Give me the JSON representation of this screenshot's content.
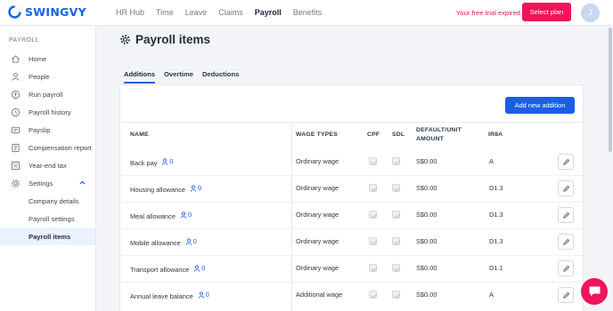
{
  "brand": {
    "name": "SWINGVY",
    "color": "#1565e0"
  },
  "nav": {
    "items": [
      {
        "label": "HR Hub"
      },
      {
        "label": "Time"
      },
      {
        "label": "Leave"
      },
      {
        "label": "Claims"
      },
      {
        "label": "Payroll",
        "active": true
      },
      {
        "label": "Benefits"
      }
    ],
    "trial_text": "Your free trial expired",
    "select_plan_label": "Select plan",
    "avatar_initial": "J"
  },
  "sidebar": {
    "heading": "PAYROLL",
    "items": [
      {
        "label": "Home",
        "icon": "home-icon"
      },
      {
        "label": "People",
        "icon": "people-icon"
      },
      {
        "label": "Run payroll",
        "icon": "run-payroll-icon"
      },
      {
        "label": "Payroll history",
        "icon": "history-icon"
      },
      {
        "label": "Payslip",
        "icon": "payslip-icon"
      },
      {
        "label": "Compensation report",
        "icon": "report-icon"
      },
      {
        "label": "Year-end tax",
        "icon": "tax-icon"
      },
      {
        "label": "Settings",
        "icon": "gear-icon",
        "expanded": true
      }
    ],
    "subitems": [
      {
        "label": "Company details"
      },
      {
        "label": "Payroll settings"
      },
      {
        "label": "Payroll items",
        "active": true
      }
    ]
  },
  "page": {
    "title": "Payroll items",
    "tabs": [
      {
        "label": "Additions",
        "active": true
      },
      {
        "label": "Overtime"
      },
      {
        "label": "Deductions"
      }
    ],
    "add_button_label": "Add new addition"
  },
  "table": {
    "headers": {
      "name": "NAME",
      "wage_types": "WAGE TYPES",
      "cpf": "CPF",
      "sdl": "SDL",
      "default_amount_1": "DEFAULT/UNIT",
      "default_amount_2": "AMOUNT",
      "ir8a": "IR8A"
    },
    "rows": [
      {
        "name": "Back pay",
        "users": "0",
        "wage_type": "Ordinary wage",
        "cpf": true,
        "sdl": true,
        "amount": "S$0.00",
        "ir8a": "A"
      },
      {
        "name": "Housing allowance",
        "users": "0",
        "wage_type": "Ordinary wage",
        "cpf": true,
        "sdl": true,
        "amount": "S$0.00",
        "ir8a": "D1.3"
      },
      {
        "name": "Meal allowance",
        "users": "0",
        "wage_type": "Ordinary wage",
        "cpf": true,
        "sdl": true,
        "amount": "S$0.00",
        "ir8a": "D1.3"
      },
      {
        "name": "Mobile allowance",
        "users": "0",
        "wage_type": "Ordinary wage",
        "cpf": true,
        "sdl": true,
        "amount": "S$0.00",
        "ir8a": "D1.3"
      },
      {
        "name": "Transport allowance",
        "users": "0",
        "wage_type": "Ordinary wage",
        "cpf": true,
        "sdl": true,
        "amount": "S$0.00",
        "ir8a": "D1.1"
      },
      {
        "name": "Annual leave balance",
        "users": "0",
        "wage_type": "Additional wage",
        "cpf": true,
        "sdl": true,
        "amount": "S$0.00",
        "ir8a": "A"
      }
    ]
  },
  "colors": {
    "accent": "#1b5ee3",
    "danger": "#f0145a",
    "chat": "#f0145a"
  }
}
